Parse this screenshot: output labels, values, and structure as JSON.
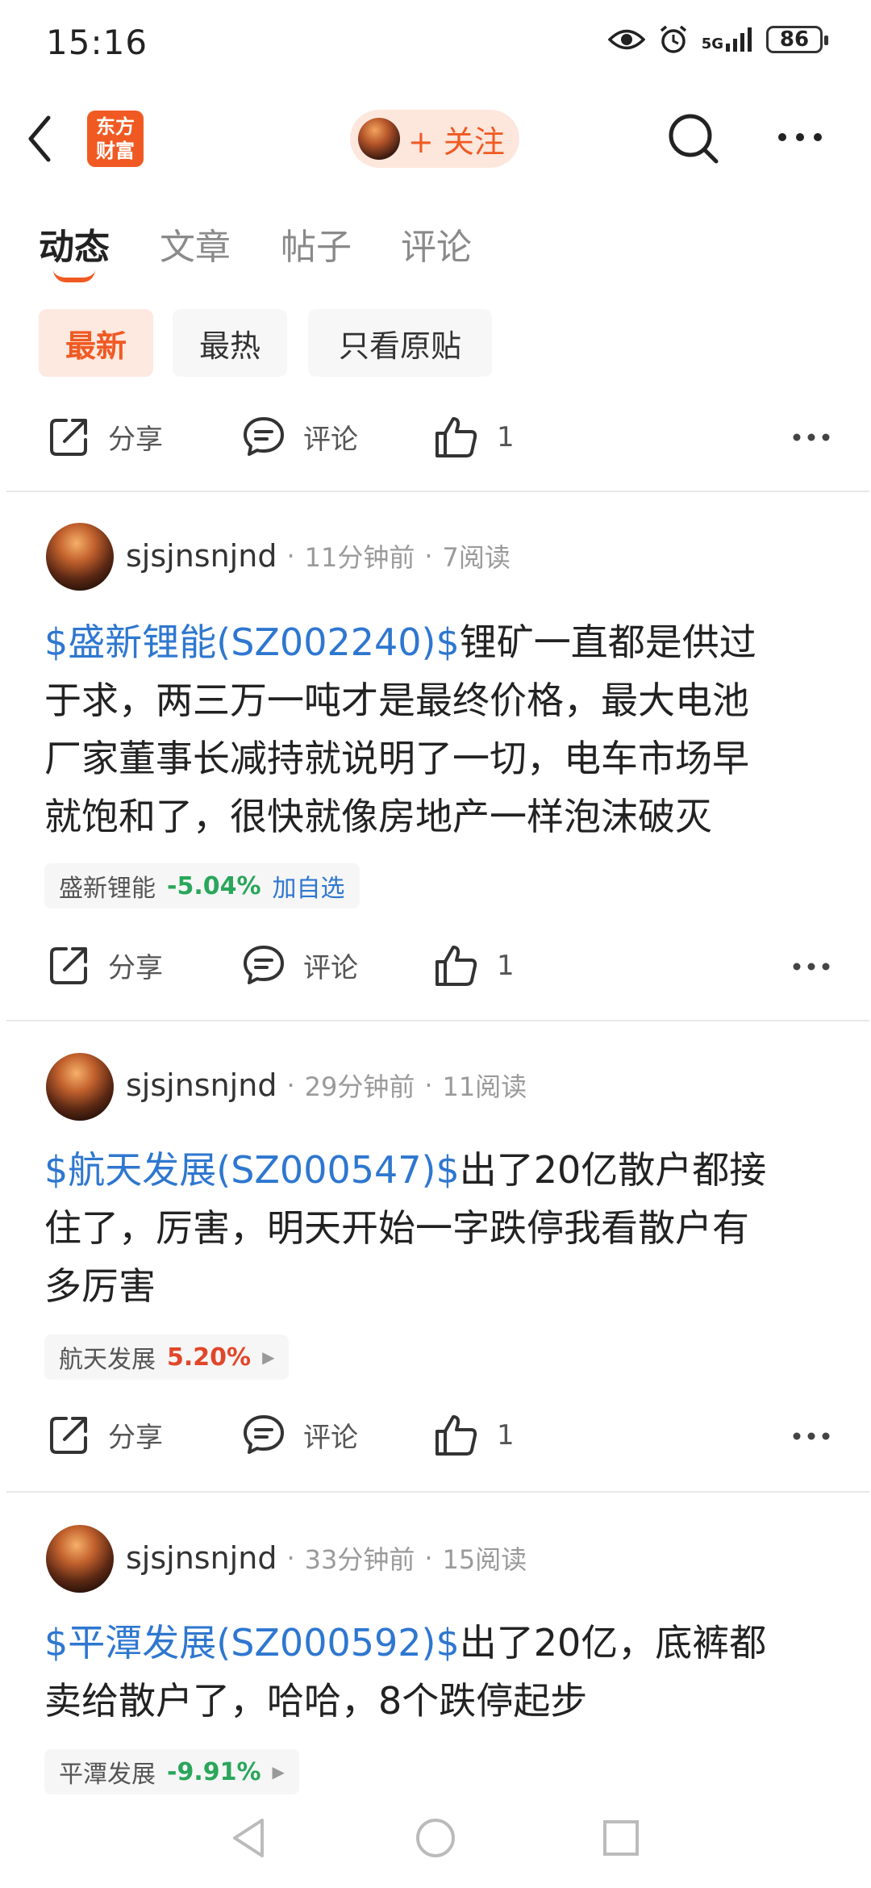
{
  "status": {
    "time": "15:16",
    "signal": "5G",
    "battery": "86"
  },
  "header": {
    "logo_line1": "东方",
    "logo_line2": "财富",
    "follow_label": "+ 关注"
  },
  "tabs": [
    {
      "label": "动态",
      "active": true
    },
    {
      "label": "文章",
      "active": false
    },
    {
      "label": "帖子",
      "active": false
    },
    {
      "label": "评论",
      "active": false
    }
  ],
  "filters": [
    {
      "label": "最新",
      "active": true
    },
    {
      "label": "最热",
      "active": false
    },
    {
      "label": "只看原贴",
      "active": false
    }
  ],
  "actions": {
    "share": "分享",
    "comment": "评论",
    "like_count": "1"
  },
  "posts": [
    {
      "user": "sjsjnsnjnd",
      "time": "11分钟前",
      "reads": "7阅读",
      "stock_link": "$盛新锂能(SZ002240)$",
      "line1": "锂矿一直都是供过",
      "line2": "于求，两三万一吨才是最终价格，最大电池",
      "line3": "厂家董事长减持就说明了一切，电车市场早",
      "line4": "就饱和了，很快就像房地产一样泡沫破灭",
      "tag_name": "盛新锂能",
      "tag_change": "-5.04%",
      "tag_action": "加自选",
      "share": "分享",
      "comment": "评论",
      "likes": "1"
    },
    {
      "user": "sjsjnsnjnd",
      "time": "29分钟前",
      "reads": "11阅读",
      "stock_link": "$航天发展(SZ000547)$",
      "line1": "出了20亿散户都接",
      "line2": "住了，厉害，明天开始一字跌停我看散户有",
      "line3": "多厉害",
      "tag_name": "航天发展",
      "tag_change": "5.20%",
      "share": "分享",
      "comment": "评论",
      "likes": "1"
    },
    {
      "user": "sjsjnsnjnd",
      "time": "33分钟前",
      "reads": "15阅读",
      "stock_link": "$平潭发展(SZ000592)$",
      "line1": "出了20亿，底裤都",
      "line2": "卖给散户了，哈哈，8个跌停起步",
      "tag_name": "平潭发展",
      "tag_change": "-9.91%"
    }
  ],
  "colors": {
    "brand": "#f05a22",
    "link": "#2e77d0",
    "down": "#2aa65b",
    "up": "#e2462a"
  },
  "icons": [
    "back-icon",
    "search-icon",
    "more-icon",
    "share-icon",
    "comment-icon",
    "like-icon",
    "eye-icon",
    "alarm-icon",
    "nav-back-icon",
    "nav-home-icon",
    "nav-recents-icon"
  ]
}
